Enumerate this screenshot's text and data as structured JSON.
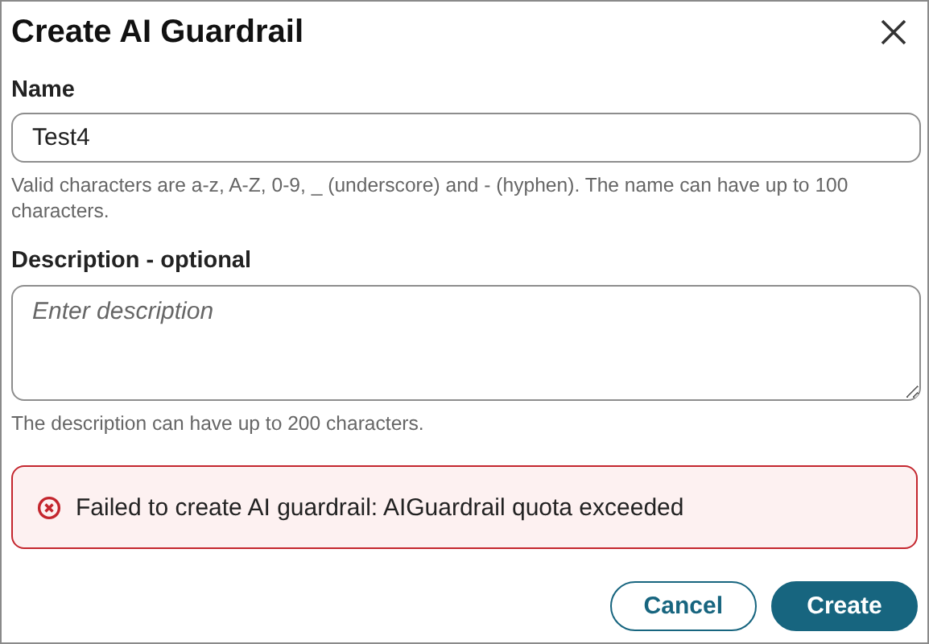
{
  "dialog": {
    "title": "Create AI Guardrail"
  },
  "name_field": {
    "label": "Name",
    "value": "Test4",
    "help": "Valid characters are a-z, A-Z, 0-9, _ (underscore) and - (hyphen). The name can have up to 100 characters."
  },
  "description_field": {
    "label": "Description - optional",
    "placeholder": "Enter description",
    "help": "The description can have up to 200 characters."
  },
  "error": {
    "message": "Failed to create AI guardrail: AIGuardrail quota exceeded"
  },
  "buttons": [
    {
      "label": "Cancel",
      "kind": "secondary"
    },
    {
      "label": "Create",
      "kind": "primary"
    }
  ]
}
